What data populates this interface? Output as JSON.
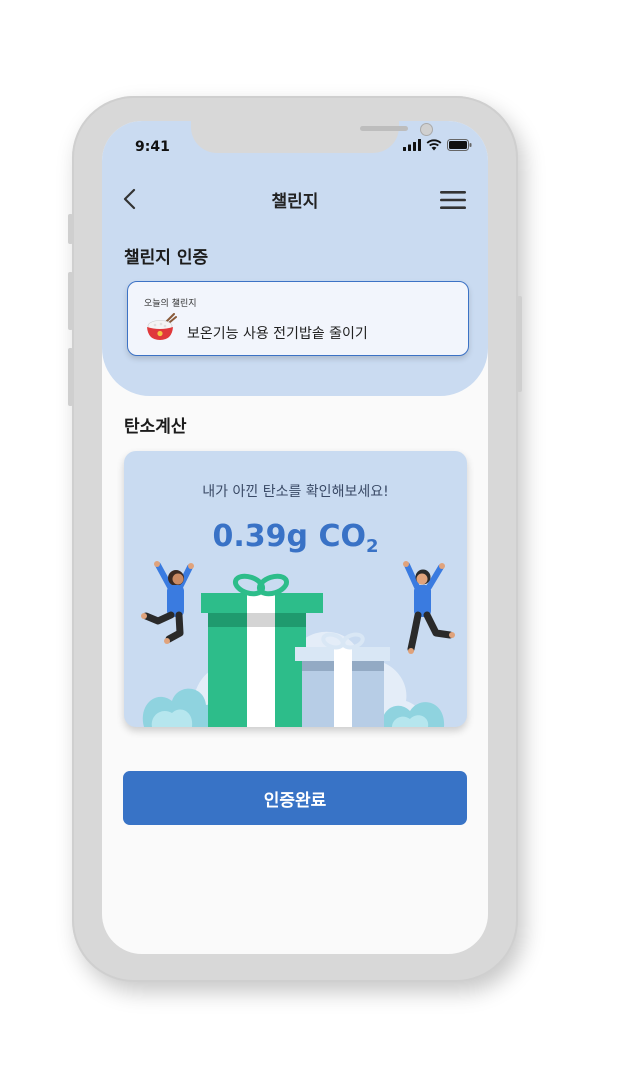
{
  "status_bar": {
    "time": "9:41"
  },
  "header": {
    "title": "챌린지"
  },
  "certification": {
    "section_title": "챌린지 인증",
    "card_label": "오늘의 챌린지",
    "challenge_text": "보온기능 사용 전기밥솥 줄이기"
  },
  "carbon": {
    "section_title": "탄소계산",
    "message": "내가 아낀 탄소를 확인해보세요!",
    "value": "0.39g CO",
    "value_subscript": "2"
  },
  "actions": {
    "confirm_label": "인증완료"
  },
  "icons": {
    "back": "chevron-left-icon",
    "menu": "hamburger-menu-icon",
    "signal": "cellular-signal-icon",
    "wifi": "wifi-icon",
    "battery": "battery-icon",
    "bowl": "rice-bowl-icon"
  },
  "colors": {
    "accent": "#3873c6",
    "header_bg": "#cadbf1",
    "card_bg": "#c9dbf1",
    "gift_green": "#2dbd8a"
  }
}
